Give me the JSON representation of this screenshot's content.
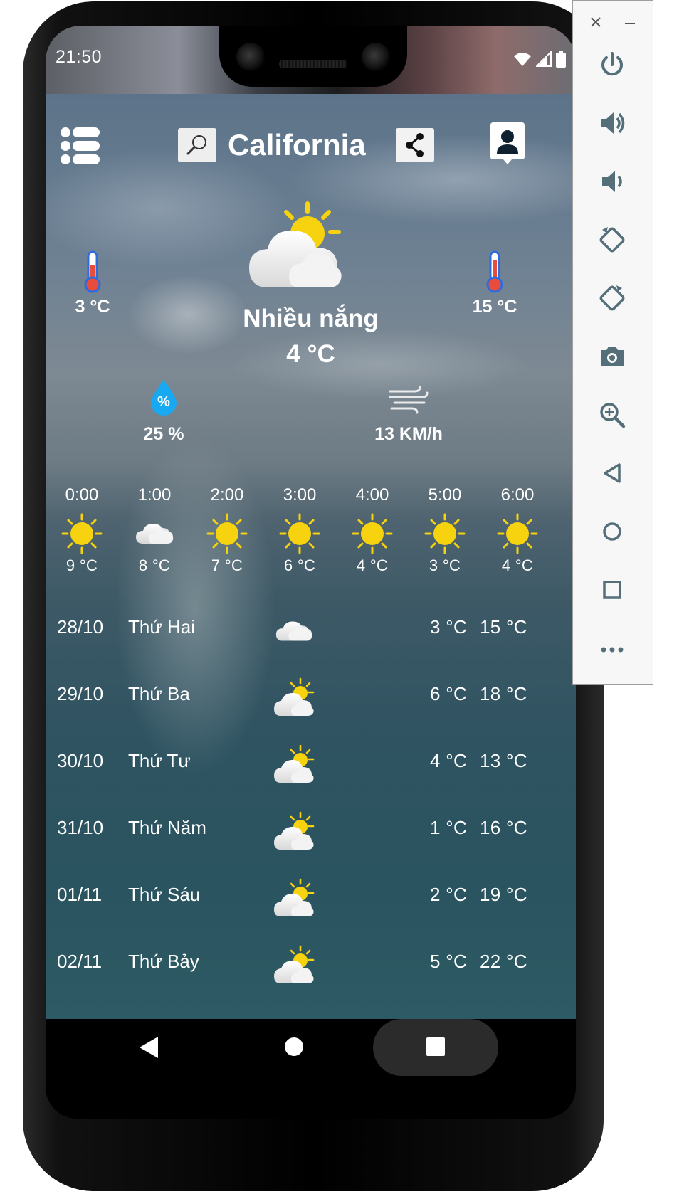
{
  "status_bar": {
    "time": "21:50"
  },
  "header": {
    "city": "California"
  },
  "current": {
    "condition": "Nhiều nắng",
    "temperature": "4 °C",
    "min_temp": "3 °C",
    "max_temp": "15 °C",
    "humidity": "25 %",
    "humidity_icon_text": "%",
    "wind": "13 KM/h"
  },
  "hourly": [
    {
      "time": "0:00",
      "temp": "9 °C",
      "icon": "sun"
    },
    {
      "time": "1:00",
      "temp": "8 °C",
      "icon": "cloud"
    },
    {
      "time": "2:00",
      "temp": "7 °C",
      "icon": "sun"
    },
    {
      "time": "3:00",
      "temp": "6 °C",
      "icon": "sun"
    },
    {
      "time": "4:00",
      "temp": "4 °C",
      "icon": "sun"
    },
    {
      "time": "5:00",
      "temp": "3 °C",
      "icon": "sun"
    },
    {
      "time": "6:00",
      "temp": "4 °C",
      "icon": "sun"
    }
  ],
  "daily": [
    {
      "date": "28/10",
      "day": "Thứ Hai",
      "min": "3 °C",
      "max": "15 °C",
      "icon": "cloud"
    },
    {
      "date": "29/10",
      "day": "Thứ Ba",
      "min": "6 °C",
      "max": "18 °C",
      "icon": "partly-sunny"
    },
    {
      "date": "30/10",
      "day": "Thứ Tư",
      "min": "4 °C",
      "max": "13 °C",
      "icon": "partly-sunny"
    },
    {
      "date": "31/10",
      "day": "Thứ Năm",
      "min": "1 °C",
      "max": "16 °C",
      "icon": "partly-sunny"
    },
    {
      "date": "01/11",
      "day": "Thứ Sáu",
      "min": "2 °C",
      "max": "19 °C",
      "icon": "partly-sunny"
    },
    {
      "date": "02/11",
      "day": "Thứ Bảy",
      "min": "5 °C",
      "max": "22 °C",
      "icon": "partly-sunny"
    }
  ],
  "colors": {
    "sun": "#f7d20f",
    "humidity_drop": "#17a9f1",
    "thermometer_bulb": "#e74c3c",
    "thermometer_body": "#2d6cdf"
  },
  "emulator_panel": {
    "icons": [
      "close-icon",
      "minimize-icon",
      "power-icon",
      "volume-up-icon",
      "volume-down-icon",
      "rotate-left-icon",
      "rotate-right-icon",
      "screenshot-icon",
      "zoom-icon",
      "back-icon",
      "home-icon",
      "overview-icon",
      "more-icon"
    ]
  }
}
